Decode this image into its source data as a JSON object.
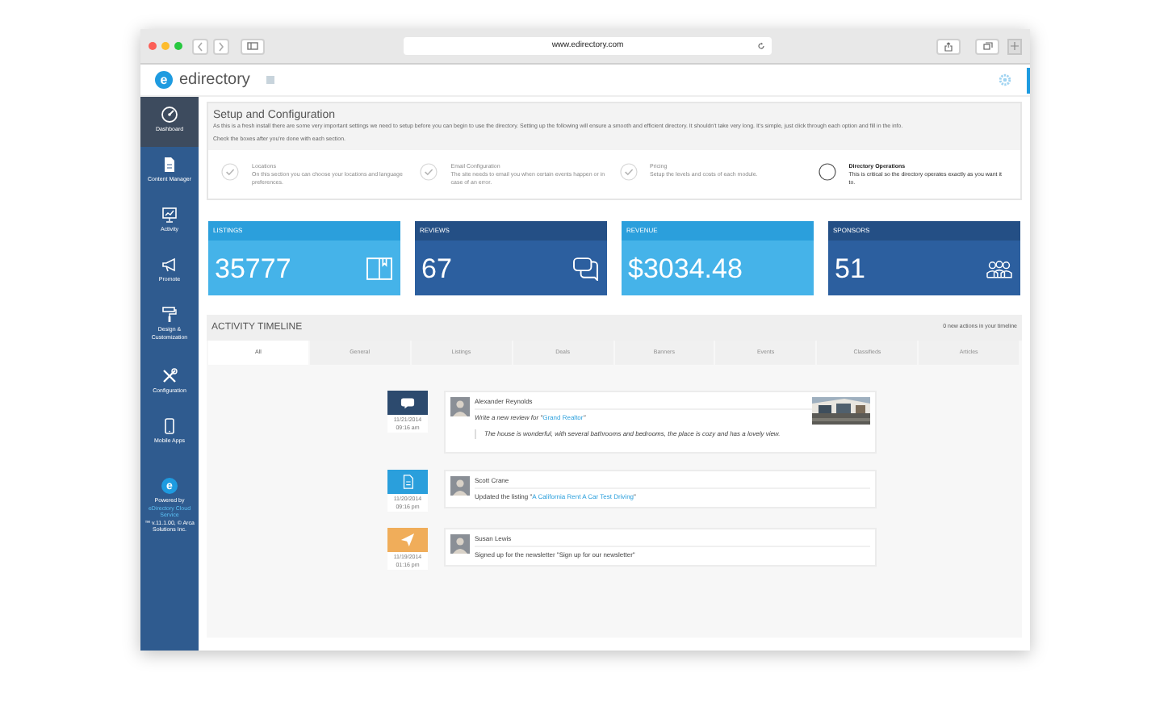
{
  "browser": {
    "url": "www.edirectory.com"
  },
  "header": {
    "logo_letter": "e",
    "brand": "edirectory"
  },
  "sidebar": {
    "items": [
      {
        "label": "Dashboard",
        "selected": true
      },
      {
        "label": "Content Manager",
        "selected": false
      },
      {
        "label": "Activity",
        "selected": false
      },
      {
        "label": "Promote",
        "selected": false
      },
      {
        "label": "Design & Customization",
        "selected": false
      },
      {
        "label": "Configuration",
        "selected": false
      },
      {
        "label": "Mobile Apps",
        "selected": false
      }
    ],
    "powered": {
      "logo_letter": "e",
      "line1": "Powered by",
      "link": "eDirectory Cloud Service",
      "line2": "™ v.11.1.00, © Arca Solutions Inc."
    }
  },
  "setup": {
    "title": "Setup and Configuration",
    "intro": "As this is a fresh install there are some very important settings we need to setup before you can begin to use the directory. Setting up the following will ensure a smooth and efficient directory. It shouldn't take very long. It's simple, just click through each option and fill in the info.",
    "hint": "Check the boxes after you're done with each section.",
    "steps": [
      {
        "title": "Locations",
        "text": "On this section you can choose your locations and language preferences.",
        "checked": true
      },
      {
        "title": "Email Configuration",
        "text": "The site needs to email you when certain events happen or in case of an error.",
        "checked": true
      },
      {
        "title": "Pricing",
        "text": "Setup the levels and costs of each module.",
        "checked": true
      },
      {
        "title": "Directory Operations",
        "text": "This is critical so the directory operates exactly as you want it to.",
        "checked": false
      }
    ]
  },
  "stats": [
    {
      "label": "LISTINGS",
      "value": "35777"
    },
    {
      "label": "REVIEWS",
      "value": "67"
    },
    {
      "label": "REVENUE",
      "value": "$3034.48"
    },
    {
      "label": "SPONSORS",
      "value": "51"
    }
  ],
  "timeline": {
    "title": "ACTIVITY TIMELINE",
    "note": "0 new actions in your timeline",
    "tabs": [
      {
        "label": "All",
        "selected": true
      },
      {
        "label": "General",
        "selected": false
      },
      {
        "label": "Listings",
        "selected": false
      },
      {
        "label": "Deals",
        "selected": false
      },
      {
        "label": "Banners",
        "selected": false
      },
      {
        "label": "Events",
        "selected": false
      },
      {
        "label": "Classifieds",
        "selected": false
      },
      {
        "label": "Articles",
        "selected": false
      }
    ],
    "items": [
      {
        "kind": "review",
        "date": "11/21/2014",
        "time": "09:16 am",
        "user": "Alexander Reynolds",
        "action": "Write a new review for \"",
        "link": "Grand Realtor",
        "after": "\"",
        "quote": "The house is wonderful, with several bathrooms and bedrooms, the place is cozy and has a lovely view."
      },
      {
        "kind": "listing",
        "date": "11/20/2014",
        "time": "09:16 pm",
        "user": "Scott Crane",
        "action": "Updated the listing \"",
        "link": "A California Rent A Car Test Driving",
        "after": "\""
      },
      {
        "kind": "newsletter",
        "date": "11/19/2014",
        "time": "01:16 pm",
        "user": "Susan Lewis",
        "action": "Signed up for the newsletter \"Sign up for our newsletter\""
      }
    ]
  }
}
